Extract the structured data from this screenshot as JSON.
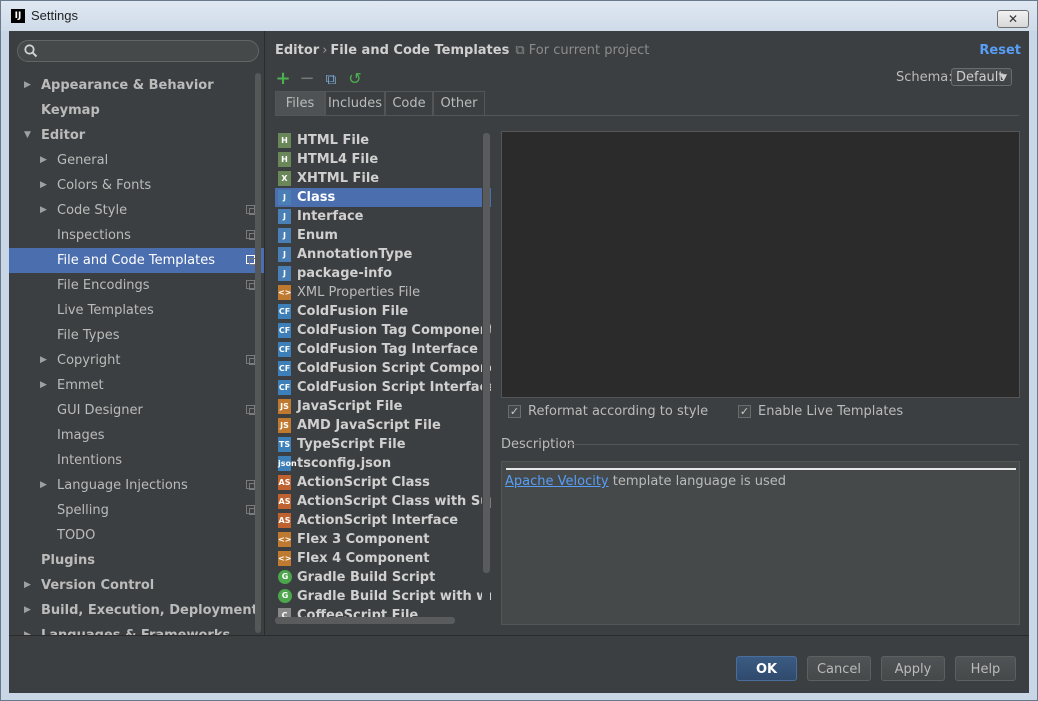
{
  "window": {
    "title": "Settings",
    "app_icon": "IJ",
    "close": "✕"
  },
  "search": {
    "placeholder": "",
    "icon": "search-icon"
  },
  "sidebar": {
    "items": [
      {
        "label": "Appearance & Behavior",
        "arrow": "▶"
      },
      {
        "label": "Keymap"
      },
      {
        "label": "Editor",
        "arrow": "▼"
      },
      {
        "label": "General",
        "arrow": "▶"
      },
      {
        "label": "Colors & Fonts",
        "arrow": "▶"
      },
      {
        "label": "Code Style",
        "arrow": "▶"
      },
      {
        "label": "Inspections"
      },
      {
        "label": "File and Code Templates"
      },
      {
        "label": "File Encodings"
      },
      {
        "label": "Live Templates"
      },
      {
        "label": "File Types"
      },
      {
        "label": "Copyright",
        "arrow": "▶"
      },
      {
        "label": "Emmet",
        "arrow": "▶"
      },
      {
        "label": "GUI Designer"
      },
      {
        "label": "Images"
      },
      {
        "label": "Intentions"
      },
      {
        "label": "Language Injections",
        "arrow": "▶"
      },
      {
        "label": "Spelling"
      },
      {
        "label": "TODO"
      },
      {
        "label": "Plugins"
      },
      {
        "label": "Version Control",
        "arrow": "▶"
      },
      {
        "label": "Build, Execution, Deployment",
        "arrow": "▶"
      },
      {
        "label": "Languages & Frameworks",
        "arrow": "▶"
      }
    ]
  },
  "header": {
    "crumb_parent": "Editor",
    "crumb_sep": "›",
    "crumb_current": "File and Code Templates",
    "scope": "For current project",
    "reset": "Reset"
  },
  "toolbar": {
    "add": "+",
    "remove": "−",
    "copy": "⧉",
    "reset": "↺"
  },
  "schema": {
    "label": "Schema:",
    "value": "Default",
    "caret": "▼"
  },
  "tabs": [
    "Files",
    "Includes",
    "Code",
    "Other"
  ],
  "files": [
    {
      "name": "HTML File",
      "icon": "H",
      "color": "#6a8759"
    },
    {
      "name": "HTML4 File",
      "icon": "H",
      "color": "#6a8759"
    },
    {
      "name": "XHTML File",
      "icon": "X",
      "color": "#6a8759"
    },
    {
      "name": "Class",
      "icon": "J",
      "color": "#4a7fb5"
    },
    {
      "name": "Interface",
      "icon": "J",
      "color": "#4a7fb5"
    },
    {
      "name": "Enum",
      "icon": "J",
      "color": "#4a7fb5"
    },
    {
      "name": "AnnotationType",
      "icon": "J",
      "color": "#4a7fb5"
    },
    {
      "name": "package-info",
      "icon": "J",
      "color": "#4a7fb5"
    },
    {
      "name": "XML Properties File",
      "icon": "<>",
      "color": "#c07a2f"
    },
    {
      "name": "ColdFusion File",
      "icon": "CF",
      "color": "#3d7fb8"
    },
    {
      "name": "ColdFusion Tag Component",
      "icon": "CF",
      "color": "#3d7fb8"
    },
    {
      "name": "ColdFusion Tag Interface",
      "icon": "CF",
      "color": "#3d7fb8"
    },
    {
      "name": "ColdFusion Script Component",
      "icon": "CF",
      "color": "#3d7fb8"
    },
    {
      "name": "ColdFusion Script Interface",
      "icon": "CF",
      "color": "#3d7fb8"
    },
    {
      "name": "JavaScript File",
      "icon": "JS",
      "color": "#c07a2f"
    },
    {
      "name": "AMD JavaScript File",
      "icon": "JS",
      "color": "#c07a2f"
    },
    {
      "name": "TypeScript File",
      "icon": "TS",
      "color": "#3d7fb8"
    },
    {
      "name": "tsconfig.json",
      "icon": "json",
      "color": "#3d7fb8"
    },
    {
      "name": "ActionScript Class",
      "icon": "AS",
      "color": "#c0622f"
    },
    {
      "name": "ActionScript Class with Supers",
      "icon": "AS",
      "color": "#c0622f"
    },
    {
      "name": "ActionScript Interface",
      "icon": "AS",
      "color": "#c0622f"
    },
    {
      "name": "Flex 3 Component",
      "icon": "<>",
      "color": "#c07a2f"
    },
    {
      "name": "Flex 4 Component",
      "icon": "<>",
      "color": "#c07a2f"
    },
    {
      "name": "Gradle Build Script",
      "icon": "G",
      "color": "#4ca64c"
    },
    {
      "name": "Gradle Build Script with wrappe",
      "icon": "G",
      "color": "#4ca64c"
    },
    {
      "name": "CoffeeScript File",
      "icon": "C",
      "color": "#888888"
    }
  ],
  "options": {
    "reformat": "Reformat according to style",
    "live_templates": "Enable Live Templates"
  },
  "description": {
    "label": "Description",
    "link": "Apache Velocity",
    "text": " template language is used"
  },
  "buttons": {
    "ok": "OK",
    "cancel": "Cancel",
    "apply": "Apply",
    "help": "Help"
  }
}
